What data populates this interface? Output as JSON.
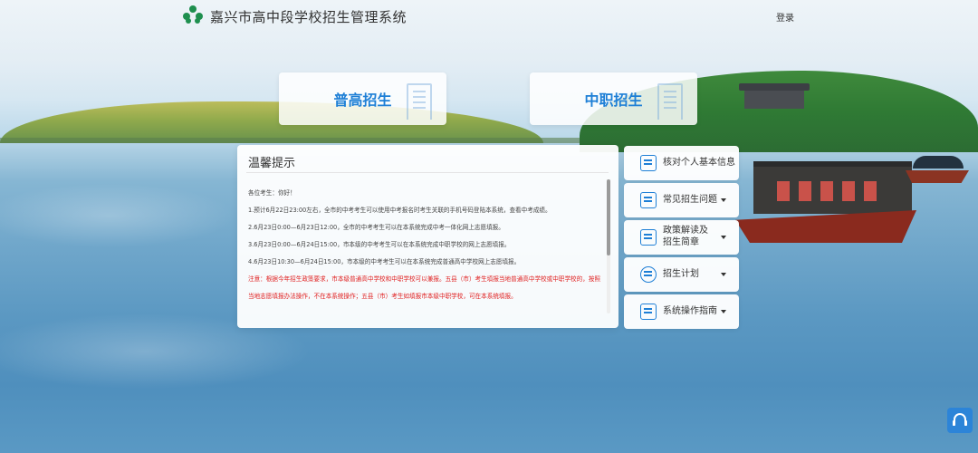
{
  "header": {
    "title": "嘉兴市高中段学校招生管理系统",
    "login": "登录",
    "logo_icon": "logo-icon"
  },
  "tiles": [
    {
      "label": "普高招生",
      "icon": "building-icon"
    },
    {
      "label": "中职招生",
      "icon": "building-icon"
    }
  ],
  "notice": {
    "title": "温馨提示",
    "greeting": "各位考生：你好！",
    "lines": [
      "1.预计6月22日23:00左右，全市的中考考生可以使用中考报名时考生关联的手机号码登陆本系统，查看中考成绩。",
      "2.6月23日0:00—6月23日12:00，全市的中考考生可以在本系统完成中考一体化网上志愿填报。",
      "3.6月23日0:00—6月24日15:00，市本级的中考考生可以在本系统完成中职学校的网上志愿填报。",
      "4.6月23日10:30—6月24日15:00，市本级的中考考生可以在本系统完成普通高中学校网上志愿填报。"
    ],
    "warning": "注意：根据今年招生政策要求，市本级普通高中学校和中职学校可以兼报。五县（市）考生填报当地普通高中学校或中职学校的，按照当地志愿填报办法操作，不在本系统操作；五县（市）考生如填报市本级中职学校，可在本系统填报。",
    "accent_warning": "#e02020"
  },
  "side_menu": [
    {
      "label": "核对个人基本信息",
      "icon": "check-list-icon",
      "dropdown": false
    },
    {
      "label": "常见招生问题",
      "icon": "edit-doc-icon",
      "dropdown": true
    },
    {
      "label_line1": "政策解读及",
      "label_line2": "招生简章",
      "icon": "search-doc-icon",
      "dropdown": true
    },
    {
      "label": "招生计划",
      "icon": "award-icon",
      "dropdown": true
    },
    {
      "label": "系统操作指南",
      "icon": "settings-doc-icon",
      "dropdown": true
    }
  ],
  "help_icon": "headset-icon",
  "colors": {
    "accent": "#1e7fd6",
    "logo": "#1e8f4e",
    "help_button": "#2c84d8"
  }
}
